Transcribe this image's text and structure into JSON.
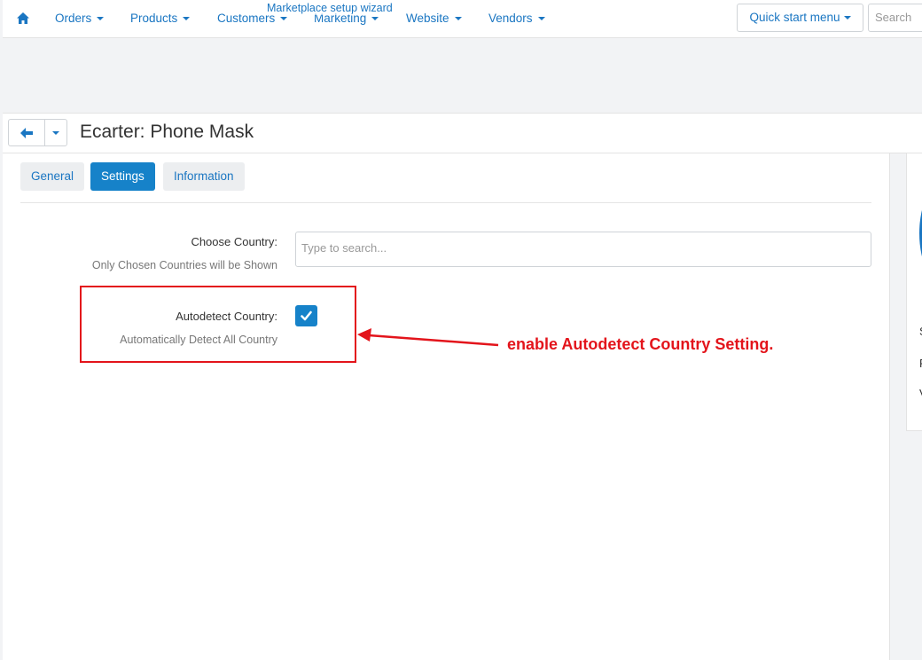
{
  "nav": {
    "items": [
      {
        "label": "Orders"
      },
      {
        "label": "Products"
      },
      {
        "label": "Customers"
      },
      {
        "label": "Marketing"
      },
      {
        "label": "Website"
      },
      {
        "label": "Vendors"
      }
    ],
    "wizard_link": "Marketplace setup wizard",
    "quick_start": "Quick start menu",
    "search_placeholder": "Search"
  },
  "titlebar": {
    "title": "Ecarter: Phone Mask"
  },
  "tabs": [
    {
      "label": "General",
      "active": false
    },
    {
      "label": "Settings",
      "active": true
    },
    {
      "label": "Information",
      "active": false
    }
  ],
  "settings": {
    "country": {
      "label": "Choose Country:",
      "hint": "Only Chosen Countries will be Shown",
      "placeholder": "Type to search..."
    },
    "autodetect": {
      "label": "Autodetect Country:",
      "hint": "Automatically Detect All Country",
      "checked": true
    }
  },
  "annotation": {
    "text": "enable Autodetect Country Setting.",
    "color": "#e3141b"
  },
  "side_panel": {
    "chars": [
      "S",
      "F",
      "V"
    ]
  },
  "colors": {
    "accent": "#1682c9",
    "link": "#1a76c2",
    "annotation": "#e3141b"
  }
}
